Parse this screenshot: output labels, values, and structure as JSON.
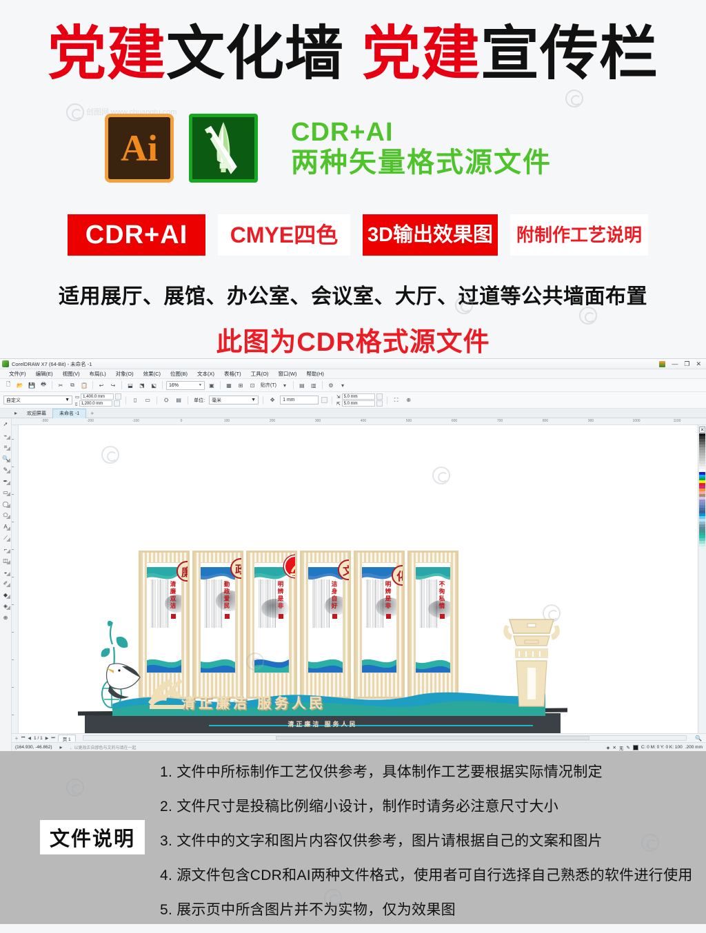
{
  "promo": {
    "title_parts": [
      {
        "text": "党建",
        "color": "#e60012"
      },
      {
        "text": "文化墙",
        "color": "#111111"
      },
      {
        "text": "党建",
        "color": "#e60012"
      },
      {
        "text": "宣传栏",
        "color": "#111111"
      }
    ],
    "title_full": "党建文化墙 党建宣传栏",
    "software": {
      "ai_label": "Ai",
      "ai_name": "adobe-illustrator-icon",
      "cdr_name": "coreldraw-icon",
      "line1": "CDR+AI",
      "line2": "两种矢量格式源文件",
      "text_color": "#4fc32c"
    },
    "badges": [
      {
        "label": "CDR+AI",
        "style": "fill",
        "bg": "#ec0000",
        "fg": "#ffffff"
      },
      {
        "label": "CMYE四色",
        "style": "ghost",
        "bg": "#ffffff",
        "fg": "#ec1c24"
      },
      {
        "label": "3D输出效果图",
        "style": "fill",
        "bg": "#ec0000",
        "fg": "#ffffff"
      },
      {
        "label": "附制作工艺说明",
        "style": "ghost",
        "bg": "#ffffff",
        "fg": "#ec1c24"
      }
    ],
    "usage_line": "适用展厅、展馆、办公室、会议室、大厅、过道等公共墙面布置",
    "format_line": "此图为CDR格式源文件",
    "watermark": "创图网 www.chuangtu.com"
  },
  "coreldraw": {
    "window_title": "CorelDRAW X7 (64-Bit) - 未命名 -1",
    "window_controls": [
      "—",
      "❐",
      "✕"
    ],
    "menus": [
      "文件(F)",
      "编辑(E)",
      "视图(V)",
      "布局(L)",
      "对象(O)",
      "效果(C)",
      "位图(B)",
      "文本(X)",
      "表格(T)",
      "工具(O)",
      "窗口(W)",
      "帮助(H)"
    ],
    "toolbar": {
      "icons": [
        {
          "name": "new-document-icon",
          "glyph": "🗋"
        },
        {
          "name": "open-document-icon",
          "glyph": "📂"
        },
        {
          "name": "save-icon",
          "glyph": "💾"
        },
        {
          "name": "print-icon",
          "glyph": "🖶"
        },
        {
          "name": "cut-icon",
          "glyph": "✂"
        },
        {
          "name": "copy-icon",
          "glyph": "⧉"
        },
        {
          "name": "paste-icon",
          "glyph": "📋"
        },
        {
          "name": "undo-icon",
          "glyph": "↩"
        },
        {
          "name": "redo-icon",
          "glyph": "↪"
        },
        {
          "name": "import-icon",
          "glyph": "⬓"
        },
        {
          "name": "export-icon",
          "glyph": "⬔"
        },
        {
          "name": "publish-pdf-icon",
          "glyph": "⬕"
        },
        {
          "name": "application-launcher-icon",
          "glyph": "⚙"
        }
      ],
      "zoom_level": "16%",
      "snap_label": "贴齐(T)",
      "extra_icons": [
        {
          "name": "options-icon",
          "glyph": "▤"
        },
        {
          "name": "object-manager-icon",
          "glyph": "▥"
        },
        {
          "name": "fullscreen-preview-icon",
          "glyph": "▣"
        }
      ]
    },
    "propertybar": {
      "page_preset": "自定义",
      "width": "1,400.0 mm",
      "height": "1,200.0 mm",
      "orientation_portrait": "portrait-icon",
      "orientation_landscape": "landscape-icon",
      "unit_label": "单位:",
      "unit_value": "毫米",
      "nudge_value": "1 mm",
      "duplicate_x": "5.0 mm",
      "duplicate_y": "5.0 mm"
    },
    "tabs": [
      {
        "label": "欢迎屏幕",
        "active": false
      },
      {
        "label": "未命名 -1",
        "active": true
      }
    ],
    "tab_add": "+",
    "toolbox": [
      {
        "name": "pick-tool",
        "glyph": "➚"
      },
      {
        "name": "shape-tool",
        "glyph": "⌁"
      },
      {
        "name": "crop-tool",
        "glyph": "⌗"
      },
      {
        "name": "zoom-tool",
        "glyph": "🔍"
      },
      {
        "name": "freehand-tool",
        "glyph": "✎"
      },
      {
        "name": "artistic-media-tool",
        "glyph": "✒"
      },
      {
        "name": "rectangle-tool",
        "glyph": "▭"
      },
      {
        "name": "ellipse-tool",
        "glyph": "◯"
      },
      {
        "name": "polygon-tool",
        "glyph": "⬠"
      },
      {
        "name": "text-tool",
        "glyph": "A"
      },
      {
        "name": "parallel-dimension-tool",
        "glyph": "⟋"
      },
      {
        "name": "straight-line-connector-tool",
        "glyph": "⌐"
      },
      {
        "name": "drop-shadow-tool",
        "glyph": "◫"
      },
      {
        "name": "transparency-tool",
        "glyph": "◒"
      },
      {
        "name": "color-eyedropper-tool",
        "glyph": "✐"
      },
      {
        "name": "interactive-fill-tool",
        "glyph": "◆"
      },
      {
        "name": "smart-fill-tool",
        "glyph": "◈"
      },
      {
        "name": "quick-customize",
        "glyph": "⊕"
      }
    ],
    "ruler": {
      "h_labels": [
        "-300",
        "-200",
        "-100",
        "0",
        "100",
        "200",
        "300",
        "400",
        "500",
        "600",
        "700",
        "800",
        "900",
        "1000",
        "1100"
      ],
      "unit": "mm"
    },
    "page_nav": {
      "first": "⏮",
      "prev": "◀",
      "counter": "1 / 1",
      "next": "▶",
      "last": "⏭",
      "add_page": "＋",
      "page_label": "页 1"
    },
    "statusbar": {
      "coords": "(164.930, -46.862)",
      "hint": "、以更改正自那色与文的与填在一起",
      "fill_label": "无",
      "outline_color": "C: 0 M: 0 Y: 0 K: 100",
      "outline_width": ".200 mm"
    },
    "palette": {
      "none_swatch": "✕",
      "grays": [
        "#1a1a1a",
        "#333333",
        "#4d4d4d",
        "#666666",
        "#808080",
        "#999999",
        "#a6a6a6",
        "#b3b3b3",
        "#c0c0c0",
        "#cccccc",
        "#d9d9d9",
        "#e6e6e6",
        "#f2f2f2",
        "#ffffff"
      ],
      "colors": [
        "#1a1ad1",
        "#00aeef",
        "#00a651",
        "#fff200",
        "#ed1c24",
        "#d4258d",
        "#f7941e",
        "#f9a8b0",
        "#b08b6b",
        "#cfc8e8",
        "#9b8fd0",
        "#7b8fc7",
        "#5f7fb5",
        "#4a6fa5",
        "#3d5f95",
        "#0095da",
        "#68c8f0",
        "#b7dff5",
        "#8fb8c9",
        "#6f99aa",
        "#5f8a99",
        "#3f9a8c",
        "#2fae9e",
        "#26c2b0",
        "#5fd0c2",
        "#9fe0d6",
        "#c9efe8",
        "#e4f6f2"
      ]
    }
  },
  "artwork": {
    "panels": [
      {
        "medallion": "廉",
        "vtext": "清廉双洁"
      },
      {
        "medallion": "政",
        "vtext": "勤政爱民"
      },
      {
        "medallion": "党徽",
        "vtext": "明辨是非"
      },
      {
        "medallion": "文",
        "vtext": "洁身自好"
      },
      {
        "medallion": "化",
        "vtext": "明辨是非"
      },
      {
        "medallion": "",
        "vtext": "不徇私情"
      }
    ],
    "gold_slogan": "清正廉洁 服务人民",
    "base_slogan": "清正廉洁  服务人民"
  },
  "footer": {
    "box_label": "文件说明",
    "notes": [
      "1. 文件中所标制作工艺仅供参考，具体制作工艺要根据实际情况制定",
      "2. 文件尺寸是投稿比例缩小设计，制作时请务必注意尺寸大小",
      "3. 文件中的文字和图片内容仅供参考，图片请根据自己的文案和图片",
      "4. 源文件包含CDR和AI两种文件格式，使用者可自行选择自己熟悉的软件进行使用",
      "5. 展示页中所含图片并不为实物，仅为效果图"
    ]
  }
}
